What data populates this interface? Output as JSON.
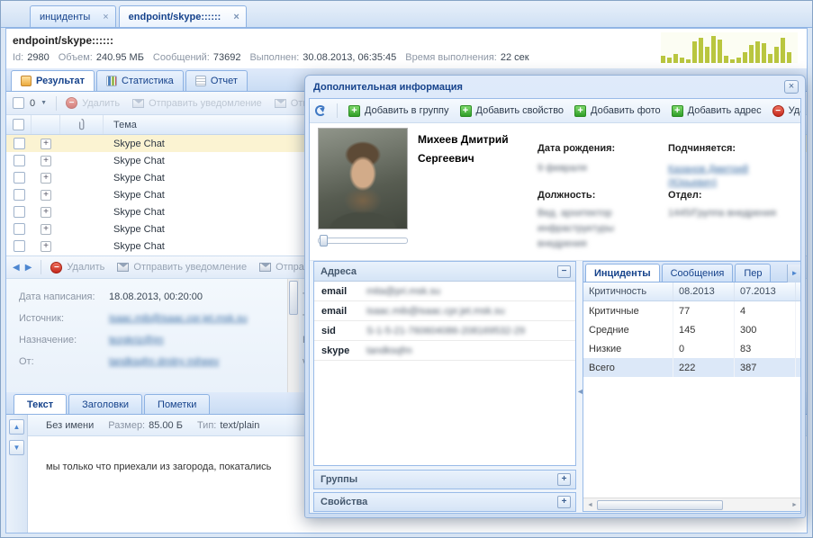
{
  "window_tabs": [
    {
      "label": "инциденты",
      "active": false
    },
    {
      "label": "endpoint/skype::::::",
      "active": true
    }
  ],
  "header": {
    "title": "endpoint/skype::::::",
    "stats": [
      {
        "label": "Id:",
        "value": "2980"
      },
      {
        "label": "Объем:",
        "value": "240.95 МБ"
      },
      {
        "label": "Сообщений:",
        "value": "73692"
      },
      {
        "label": "Выполнен:",
        "value": "30.08.2013, 06:35:45"
      },
      {
        "label": "Время выполнения:",
        "value": "22 сек"
      }
    ]
  },
  "chart_data": {
    "type": "bar",
    "title": "",
    "values": [
      4,
      3,
      5,
      3,
      2,
      12,
      14,
      9,
      15,
      13,
      4,
      2,
      3,
      6,
      10,
      12,
      11,
      5,
      9,
      14,
      6
    ],
    "color": "#b9c63f"
  },
  "result_tabs": [
    {
      "label": "Результат",
      "active": true,
      "icon": "result-icon"
    },
    {
      "label": "Статистика",
      "active": false,
      "icon": "stats-icon"
    },
    {
      "label": "Отчет",
      "active": false,
      "icon": "report-icon"
    }
  ],
  "grid_toolbar": {
    "count": "0",
    "buttons": [
      "Удалить",
      "Отправить уведомление",
      "Отправить"
    ]
  },
  "result_table": {
    "column": "Тема",
    "rows": [
      "Skype Chat",
      "Skype Chat",
      "Skype Chat",
      "Skype Chat",
      "Skype Chat",
      "Skype Chat",
      "Skype Chat"
    ],
    "selected_index": 0
  },
  "message_toolbar": {
    "delete": "Удалить",
    "notify": "Отправить уведомление",
    "notify2": "Отправить"
  },
  "detail": {
    "fields": [
      {
        "label": "Дата написания:",
        "value": "18.08.2013, 00:20:00",
        "blurred": false,
        "link": false
      },
      {
        "label": "Источник:",
        "value": "isaac.mib@isaac.cpr.jet.msk.su",
        "blurred": true,
        "link": true
      },
      {
        "label": "Назначение:",
        "value": "tezgkriz@jm",
        "blurred": true,
        "link": true
      },
      {
        "label": "От:",
        "value": "tandksqfm dmitry miheev",
        "blurred": true,
        "link": true
      }
    ],
    "cut_labels": [
      "Т",
      "Т",
      "Р",
      "v1"
    ]
  },
  "bottom_tabs": [
    {
      "label": "Текст",
      "active": true
    },
    {
      "label": "Заголовки",
      "active": false
    },
    {
      "label": "Пометки",
      "active": false
    }
  ],
  "attachment": {
    "name": "Без имени",
    "size_label": "Размер:",
    "size": "85.00 Б",
    "type_label": "Тип:",
    "type": "text/plain"
  },
  "message_text": "мы только что приехали из загорода, покатались",
  "dialog": {
    "title": "Дополнительная информация",
    "toolbar": [
      {
        "label": "Добавить в группу",
        "icon": "plus"
      },
      {
        "label": "Добавить свойство",
        "icon": "plus"
      },
      {
        "label": "Добавить фото",
        "icon": "plus"
      },
      {
        "label": "Добавить адрес",
        "icon": "plus"
      },
      {
        "label": "Уда",
        "icon": "minus"
      }
    ],
    "person": {
      "name_line1": "Михеев Дмитрий",
      "name_line2": "Сергеевич",
      "birth_label": "Дата рождения:",
      "birth_value": "9 февраля",
      "position_label": "Должность:",
      "position_values": [
        "Вед. архитектор",
        "инфраструктуры",
        "внедрения"
      ],
      "manager_label": "Подчиняется:",
      "manager_value": "Казанов Дмитрий (Юрьевич)",
      "department_label": "Отдел:",
      "department_value": "1445/Группа внедрения"
    },
    "addresses": {
      "title": "Адреса",
      "rows": [
        {
          "key": "email",
          "value": "mita@pri.msk.su"
        },
        {
          "key": "email",
          "value": "isaac.mib@isaac.cpr.jet.msk.su"
        },
        {
          "key": "sid",
          "value": "S-1-5-21-760604086-208169532-29"
        },
        {
          "key": "skype",
          "value": "tandksqfm"
        }
      ]
    },
    "groups_title": "Группы",
    "properties_title": "Свойства",
    "incidents": {
      "tabs": [
        {
          "label": "Инциденты",
          "active": true
        },
        {
          "label": "Сообщения",
          "active": false
        },
        {
          "label": "Пер",
          "active": false
        }
      ],
      "columns": [
        "Критичность",
        "08.2013",
        "07.2013"
      ],
      "rows": [
        [
          "Критичные",
          "77",
          "4"
        ],
        [
          "Средние",
          "145",
          "300"
        ],
        [
          "Низкие",
          "0",
          "83"
        ],
        [
          "Всего",
          "222",
          "387"
        ]
      ],
      "selected_row": 3
    }
  }
}
